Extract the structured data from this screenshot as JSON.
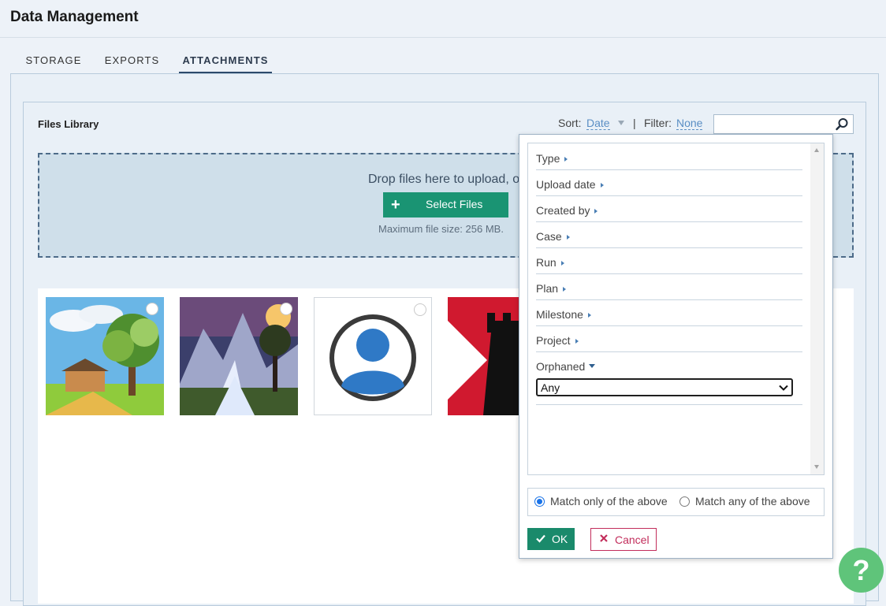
{
  "header": {
    "title": "Data Management"
  },
  "tabs": [
    {
      "label": "STORAGE",
      "active": false
    },
    {
      "label": "EXPORTS",
      "active": false
    },
    {
      "label": "ATTACHMENTS",
      "active": true
    }
  ],
  "library": {
    "title": "Files Library",
    "sort_label": "Sort:",
    "sort_value": "Date",
    "separator": "|",
    "filter_label": "Filter:",
    "filter_value": "None",
    "search": {
      "placeholder": "",
      "value": ""
    }
  },
  "dropzone": {
    "text": "Drop files here to upload, o",
    "button_label": "Select Files",
    "button_icon": "plus-icon",
    "max_size_text": "Maximum file size: 256 MB."
  },
  "files": [
    {
      "name": "landscape-thumbnail"
    },
    {
      "name": "mountain-waterfall-thumbnail"
    },
    {
      "name": "avatar-thumbnail"
    },
    {
      "name": "tower-logo-thumbnail"
    }
  ],
  "filter_popup": {
    "items": [
      {
        "label": "Type"
      },
      {
        "label": "Upload date"
      },
      {
        "label": "Created by"
      },
      {
        "label": "Case"
      },
      {
        "label": "Run"
      },
      {
        "label": "Plan"
      },
      {
        "label": "Milestone"
      },
      {
        "label": "Project"
      }
    ],
    "orphaned": {
      "label": "Orphaned",
      "selected": "Any"
    },
    "match_only_label": "Match only of the above",
    "match_any_label": "Match any of the above",
    "match_selected": "only",
    "ok_label": "OK",
    "cancel_label": "Cancel"
  },
  "help": {
    "label": "?"
  },
  "colors": {
    "accent_green": "#1a9473",
    "link_blue": "#5a8ec4",
    "cancel_red": "#c22d5b",
    "help_green": "#5fc47a"
  }
}
